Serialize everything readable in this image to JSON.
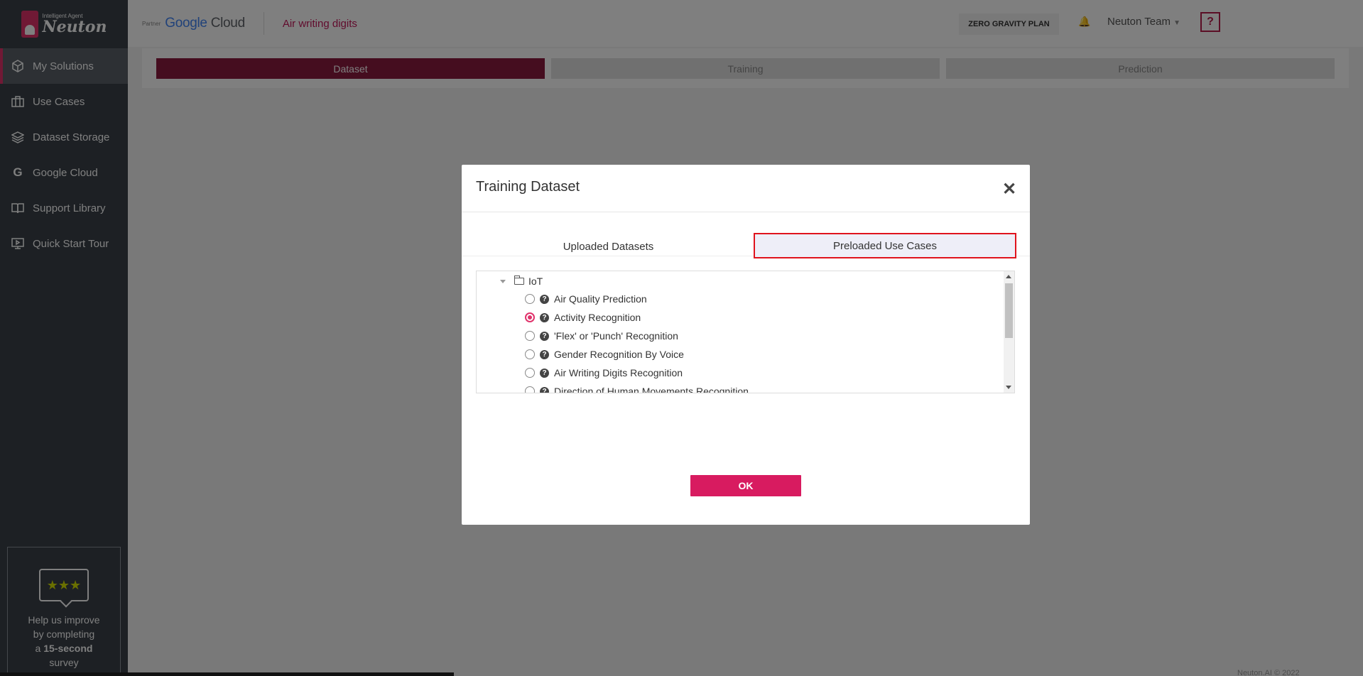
{
  "brand": {
    "logo_sub": "Intelligent Agent",
    "logo_name": "Neuton",
    "accent": "#e0336b"
  },
  "sidebar": {
    "items": [
      {
        "label": "My Solutions",
        "icon": "cube-icon",
        "active": true
      },
      {
        "label": "Use Cases",
        "icon": "briefcase-icon"
      },
      {
        "label": "Dataset Storage",
        "icon": "layers-icon"
      },
      {
        "label": "Google Cloud",
        "icon": "google-icon"
      },
      {
        "label": "Support Library",
        "icon": "book-icon"
      },
      {
        "label": "Quick Start Tour",
        "icon": "presentation-icon"
      }
    ],
    "survey": {
      "line1": "Help us improve",
      "line2": "by completing",
      "line3_prefix": "a",
      "line3_bold": "15-second",
      "line4": "survey"
    }
  },
  "header": {
    "partner": "Partner",
    "google": "Google",
    "cloud": "Cloud",
    "project": "Air writing digits",
    "plan": "ZERO GRAVITY PLAN",
    "team": "Neuton Team",
    "help": "?"
  },
  "steps": [
    "Dataset",
    "Training",
    "Prediction"
  ],
  "footer": {
    "copyright": "Neuton.AI © 2022"
  },
  "modal": {
    "title": "Training Dataset",
    "close": "✕",
    "tabs": [
      "Uploaded Datasets",
      "Preloaded Use Cases"
    ],
    "active_tab": "Preloaded Use Cases",
    "folder": "IoT",
    "items": [
      {
        "label": "Air Quality Prediction",
        "selected": false
      },
      {
        "label": "Activity Recognition",
        "selected": true
      },
      {
        "label": "'Flex' or 'Punch' Recognition",
        "selected": false
      },
      {
        "label": "Gender Recognition By Voice",
        "selected": false
      },
      {
        "label": "Air Writing Digits Recognition",
        "selected": false
      },
      {
        "label": "Direction of Human Movements Recognition",
        "selected": false
      }
    ],
    "ok": "OK"
  }
}
